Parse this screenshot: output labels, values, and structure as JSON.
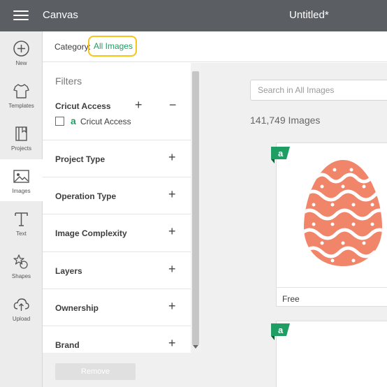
{
  "header": {
    "app_title": "Canvas",
    "doc_title": "Untitled*",
    "bg_color": "#5b5e63"
  },
  "sidebar": {
    "items": [
      {
        "label": "New",
        "icon": "plus-circle-icon",
        "active": false
      },
      {
        "label": "Templates",
        "icon": "shirt-icon",
        "active": false
      },
      {
        "label": "Projects",
        "icon": "projects-icon",
        "active": false
      },
      {
        "label": "Images",
        "icon": "image-icon",
        "active": true
      },
      {
        "label": "Text",
        "icon": "text-icon",
        "active": false
      },
      {
        "label": "Shapes",
        "icon": "shapes-icon",
        "active": false
      },
      {
        "label": "Upload",
        "icon": "upload-icon",
        "active": false
      }
    ]
  },
  "category": {
    "label": "Category:",
    "value": "All Images",
    "value_color": "#1f9e64",
    "highlight_color": "#f5c518"
  },
  "filters": {
    "title": "Filters",
    "cricut_access": {
      "label": "Cricut Access",
      "expand_symbol": "+",
      "collapse_symbol": "−",
      "badge": "a",
      "checkbox_label": "Cricut Access",
      "checked": false
    },
    "sections": [
      {
        "label": "Project Type",
        "symbol": "+"
      },
      {
        "label": "Operation Type",
        "symbol": "+"
      },
      {
        "label": "Image Complexity",
        "symbol": "+"
      },
      {
        "label": "Layers",
        "symbol": "+"
      },
      {
        "label": "Ownership",
        "symbol": "+"
      },
      {
        "label": "Brand",
        "symbol": "+"
      }
    ],
    "remove_label": "Remove"
  },
  "results": {
    "search_placeholder": "Search in All Images",
    "count": "141,749 Images",
    "cards": [
      {
        "label": "Free",
        "image": "easter-egg-image",
        "egg_color": "#f0856a",
        "tag_color": "#1f9e64"
      },
      {
        "label": "",
        "image": "",
        "tag_color": "#1f9e64"
      }
    ],
    "tag_badge": "a"
  }
}
